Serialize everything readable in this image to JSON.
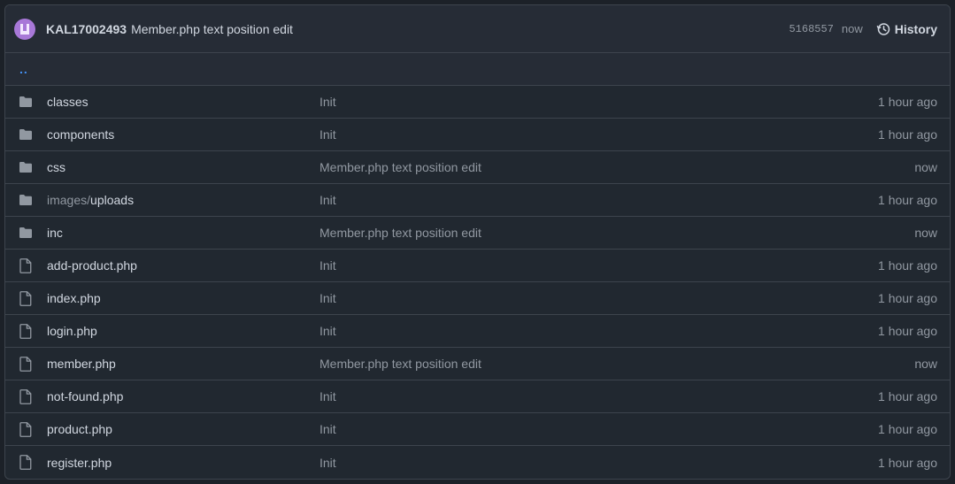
{
  "commit": {
    "author": "KAL17002493",
    "message": "Member.php text position edit",
    "sha": "5168557",
    "time": "now",
    "history_label": "History"
  },
  "parent_link": "..",
  "files": [
    {
      "type": "folder",
      "prefix": "",
      "name": "classes",
      "message": "Init",
      "age": "1 hour ago"
    },
    {
      "type": "folder",
      "prefix": "",
      "name": "components",
      "message": "Init",
      "age": "1 hour ago"
    },
    {
      "type": "folder",
      "prefix": "",
      "name": "css",
      "message": "Member.php text position edit",
      "age": "now"
    },
    {
      "type": "folder",
      "prefix": "images/",
      "name": "uploads",
      "message": "Init",
      "age": "1 hour ago"
    },
    {
      "type": "folder",
      "prefix": "",
      "name": "inc",
      "message": "Member.php text position edit",
      "age": "now"
    },
    {
      "type": "file",
      "prefix": "",
      "name": "add-product.php",
      "message": "Init",
      "age": "1 hour ago"
    },
    {
      "type": "file",
      "prefix": "",
      "name": "index.php",
      "message": "Init",
      "age": "1 hour ago"
    },
    {
      "type": "file",
      "prefix": "",
      "name": "login.php",
      "message": "Init",
      "age": "1 hour ago"
    },
    {
      "type": "file",
      "prefix": "",
      "name": "member.php",
      "message": "Member.php text position edit",
      "age": "now"
    },
    {
      "type": "file",
      "prefix": "",
      "name": "not-found.php",
      "message": "Init",
      "age": "1 hour ago"
    },
    {
      "type": "file",
      "prefix": "",
      "name": "product.php",
      "message": "Init",
      "age": "1 hour ago"
    },
    {
      "type": "file",
      "prefix": "",
      "name": "register.php",
      "message": "Init",
      "age": "1 hour ago"
    }
  ]
}
